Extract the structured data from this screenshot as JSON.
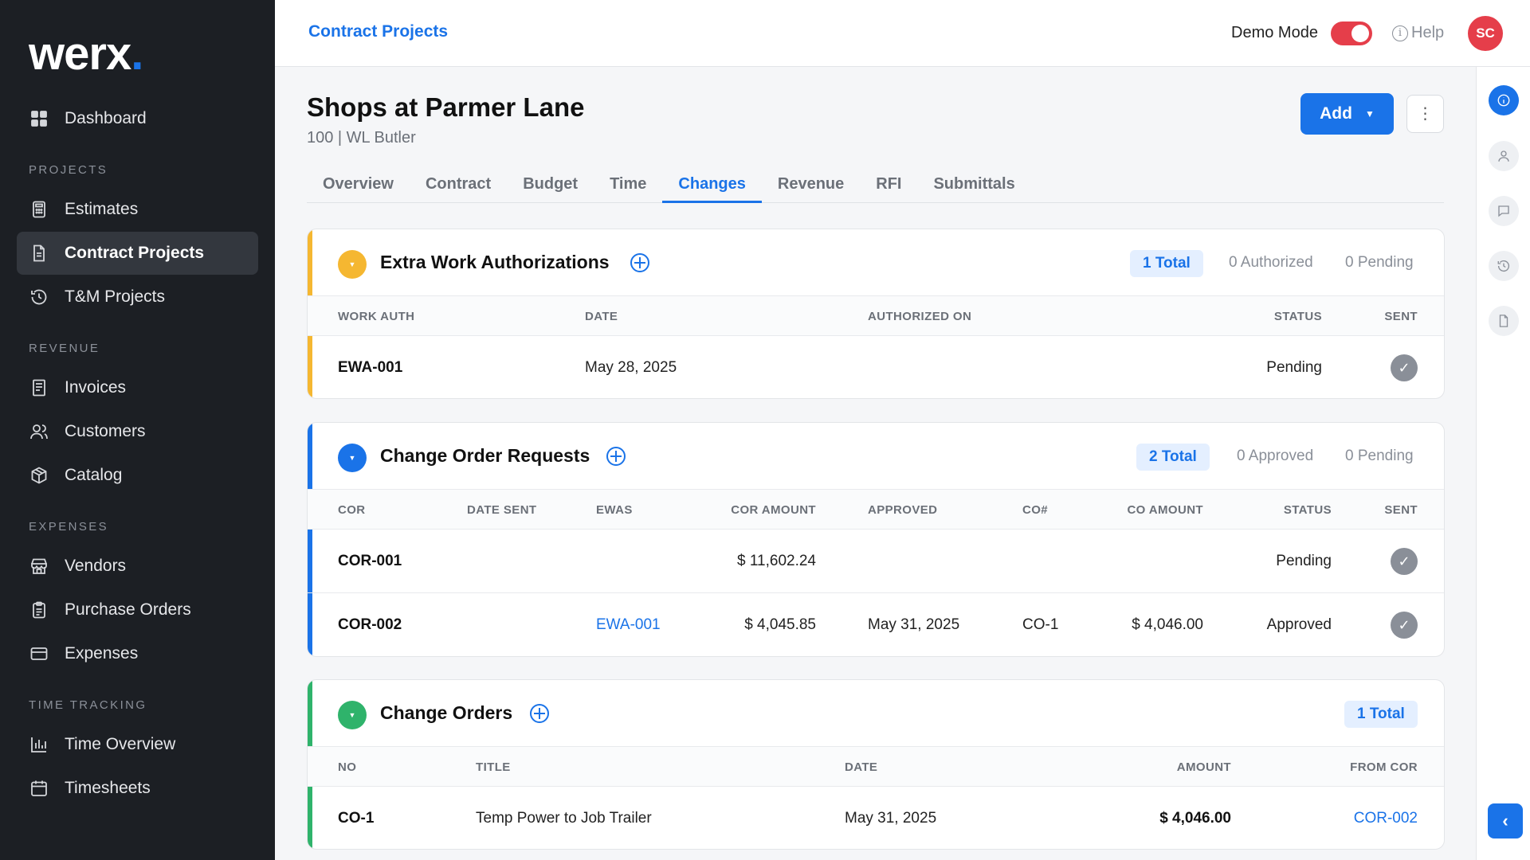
{
  "app": {
    "logo": "werx",
    "logo_dot": "."
  },
  "sidebar": {
    "dashboard": "Dashboard",
    "sections": {
      "projects": "PROJECTS",
      "revenue": "REVENUE",
      "expenses": "EXPENSES",
      "time_tracking": "TIME TRACKING"
    },
    "items": {
      "estimates": "Estimates",
      "contract_projects": "Contract Projects",
      "tm_projects": "T&M Projects",
      "invoices": "Invoices",
      "customers": "Customers",
      "catalog": "Catalog",
      "vendors": "Vendors",
      "purchase_orders": "Purchase Orders",
      "expenses": "Expenses",
      "time_overview": "Time Overview",
      "timesheets": "Timesheets"
    }
  },
  "topbar": {
    "breadcrumb": "Contract Projects",
    "demo_mode_label": "Demo Mode",
    "demo_mode_on": true,
    "help_label": "Help",
    "avatar_initials": "SC"
  },
  "project": {
    "title": "Shops at Parmer Lane",
    "subtitle": "100 | WL Butler",
    "add_label": "Add",
    "more_label": "⋮"
  },
  "tabs": [
    "Overview",
    "Contract",
    "Budget",
    "Time",
    "Changes",
    "Revenue",
    "RFI",
    "Submittals"
  ],
  "active_tab": "Changes",
  "colors": {
    "accent": "#1a73e8",
    "ewa": "#f5b731",
    "cor": "#1a73e8",
    "co": "#2fb36b",
    "danger": "#e53e4a"
  },
  "ewa": {
    "title": "Extra Work Authorizations",
    "total": "1 Total",
    "authorized": "0 Authorized",
    "pending": "0 Pending",
    "columns": {
      "work_auth": "WORK AUTH",
      "date": "DATE",
      "authorized_on": "AUTHORIZED ON",
      "status": "STATUS",
      "sent": "SENT"
    },
    "rows": [
      {
        "work_auth": "EWA-001",
        "date": "May 28, 2025",
        "authorized_on": "",
        "status": "Pending",
        "sent": "✓"
      }
    ]
  },
  "cor": {
    "title": "Change Order Requests",
    "total": "2 Total",
    "approved": "0 Approved",
    "pending": "0 Pending",
    "columns": {
      "cor": "COR",
      "date_sent": "DATE SENT",
      "ewas": "EWAS",
      "cor_amount": "COR AMOUNT",
      "approved": "APPROVED",
      "co_no": "CO#",
      "co_amount": "CO AMOUNT",
      "status": "STATUS",
      "sent": "SENT"
    },
    "rows": [
      {
        "cor": "COR-001",
        "date_sent": "",
        "ewas": "",
        "cor_amount": "$ 11,602.24",
        "approved": "",
        "co_no": "",
        "co_amount": "",
        "status": "Pending",
        "sent": "✓"
      },
      {
        "cor": "COR-002",
        "date_sent": "",
        "ewas": "EWA-001",
        "cor_amount": "$ 4,045.85",
        "approved": "May 31, 2025",
        "co_no": "CO-1",
        "co_amount": "$ 4,046.00",
        "status": "Approved",
        "sent": "✓"
      }
    ]
  },
  "co": {
    "title": "Change Orders",
    "total": "1 Total",
    "columns": {
      "no": "NO",
      "title": "TITLE",
      "date": "DATE",
      "amount": "AMOUNT",
      "from_cor": "FROM COR"
    },
    "rows": [
      {
        "no": "CO-1",
        "title": "Temp Power to Job Trailer",
        "date": "May 31, 2025",
        "amount": "$ 4,046.00",
        "from_cor": "COR-002"
      }
    ]
  }
}
